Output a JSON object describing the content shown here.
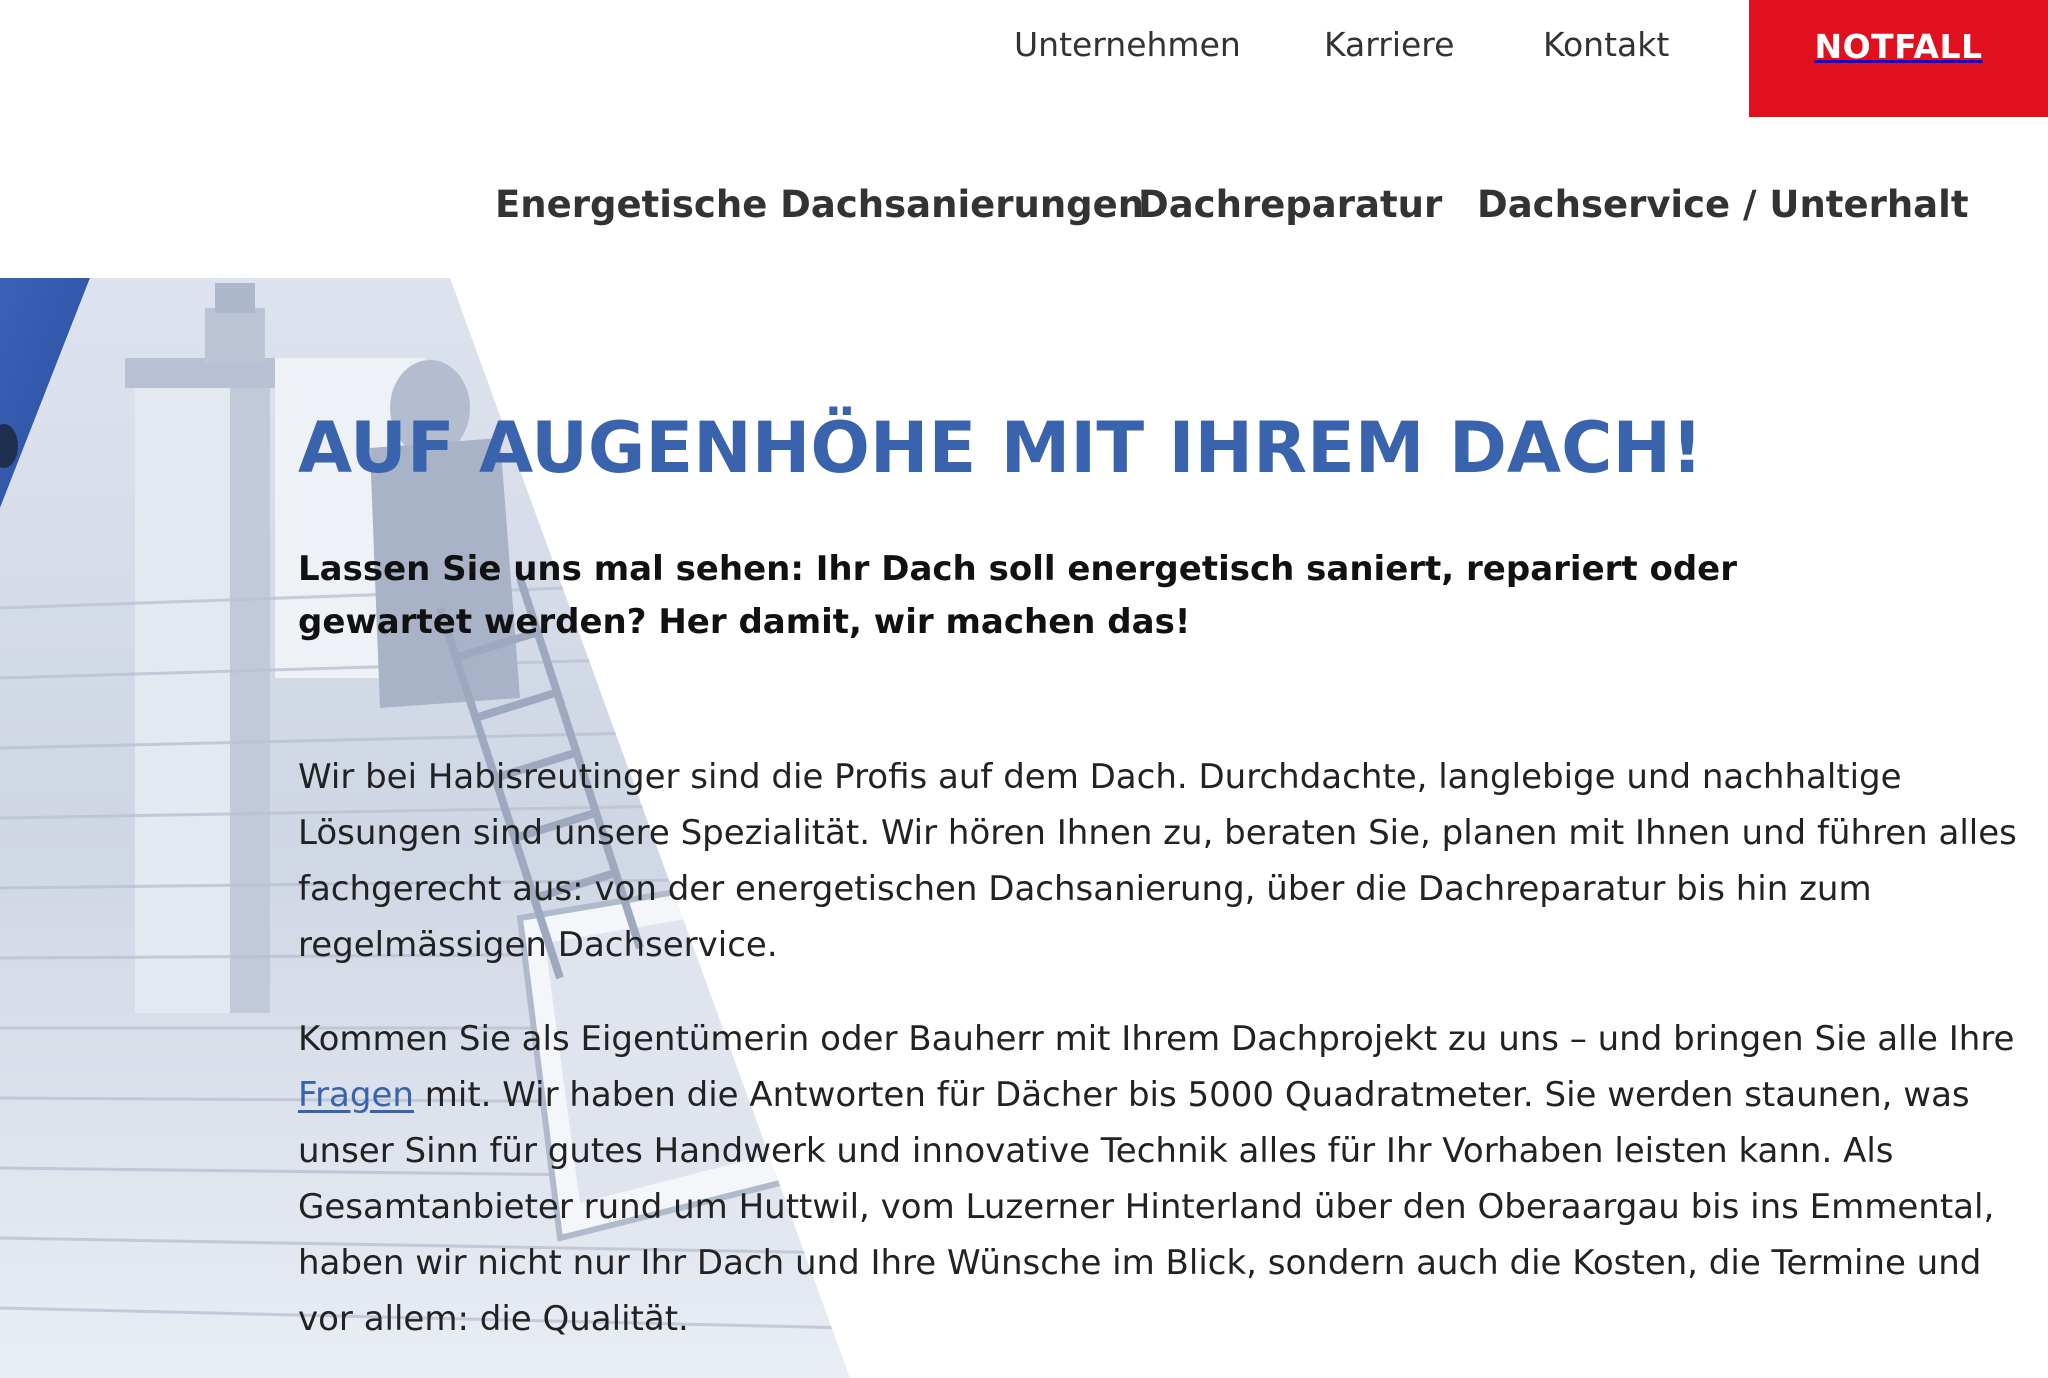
{
  "top_nav": {
    "items": [
      "Unternehmen",
      "Karriere",
      "Kontakt"
    ],
    "emergency_label": "NOTFALL"
  },
  "main_nav": {
    "items": [
      "Energetische Dachsanierungen",
      "Dachreparatur",
      "Dachservice / Unterhalt"
    ]
  },
  "hero": {
    "headline": "AUF AUGENHÖHE MIT IHREM DACH!",
    "lead": "Lassen Sie uns mal sehen: Ihr Dach soll energetisch saniert, repariert oder gewartet werden? Her damit, wir machen das!",
    "paragraph1": "Wir bei Habisreutinger sind die Profis auf dem Dach. Durchdachte, langlebige und nachhaltige Lösungen sind unsere Spezialität. Wir hören Ihnen zu, beraten Sie, planen mit Ihnen und führen alles fachgerecht aus: von der energetischen Dachsanierung, über die Dachreparatur bis hin zum regelmässigen Dachservice.",
    "paragraph2_before": "Kommen Sie als Eigentümerin oder Bauherr mit Ihrem Dachprojekt zu uns – und bringen Sie alle Ihre ",
    "paragraph2_link": "Fragen",
    "paragraph2_after": " mit. Wir haben die Antworten für Dächer bis 5000 Quadratmeter. Sie werden staunen, was unser Sinn für gutes Handwerk und innovative Technik alles für Ihr Vorhaben leisten kann. Als Gesamtanbieter rund um Huttwil, vom Luzerner Hinterland über den Oberaargau bis ins Emmental, haben wir nicht nur Ihr Dach und Ihre Wünsche im Blick, sondern auch die Kosten, die Termine und vor allem: die Qualität."
  },
  "colors": {
    "accent_blue": "#3a63ad",
    "emergency_red": "#e2101f"
  }
}
